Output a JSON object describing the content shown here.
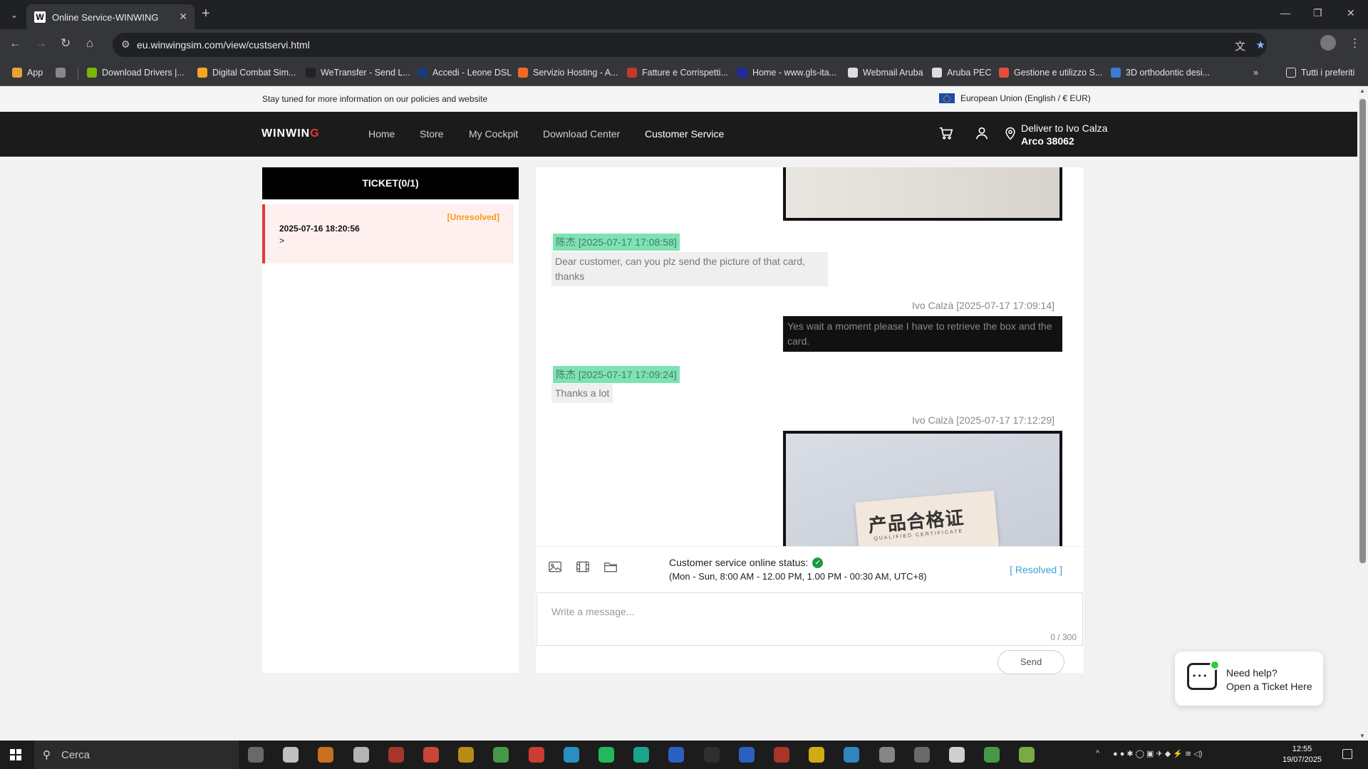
{
  "browser": {
    "tab_title": "Online Service-WINWING",
    "tab_favicon": "W",
    "url": "eu.winwingsim.com/view/custservi.html",
    "bookmarks": [
      {
        "label": "App",
        "icon": "apps-grid-icon",
        "color": "#e9a23b"
      },
      {
        "label": "",
        "icon": "grid-icon",
        "color": "#888888"
      },
      {
        "label": "Download Drivers |...",
        "icon": "nvidia-icon",
        "color": "#76b900"
      },
      {
        "label": "Digital Combat Sim...",
        "icon": "dcs-icon",
        "color": "#f5a623"
      },
      {
        "label": "WeTransfer - Send L...",
        "icon": "wetransfer-icon",
        "color": "#222222"
      },
      {
        "label": "Accedi - Leone DSL",
        "icon": "leone-icon",
        "color": "#1a3c7a"
      },
      {
        "label": "Servizio Hosting - A...",
        "icon": "aruba-icon",
        "color": "#f26b21"
      },
      {
        "label": "Fatture e Corrispetti...",
        "icon": "agenzia-entrate-icon",
        "color": "#c0392b"
      },
      {
        "label": "Home - www.gls-ita...",
        "icon": "gls-icon",
        "color": "#1e2a9e"
      },
      {
        "label": "Webmail Aruba",
        "icon": "aruba-cloud-icon",
        "color": "#dddddd"
      },
      {
        "label": "Aruba PEC",
        "icon": "aruba-pec-icon",
        "color": "#dddddd"
      },
      {
        "label": "Gestione e utilizzo S...",
        "icon": "plus-icon",
        "color": "#e74c3c"
      },
      {
        "label": "3D orthodontic desi...",
        "icon": "ortho-icon",
        "color": "#3a7bd5"
      }
    ],
    "all_bookmarks_label": "Tutti i preferiti"
  },
  "site": {
    "announcement": "Stay tuned for more information on our policies and website",
    "region": "European Union (English / € EUR)",
    "logo_main": "WINWIN",
    "logo_accent": "G",
    "nav": [
      "Home",
      "Store",
      "My Cockpit",
      "Download Center",
      "Customer Service"
    ],
    "active_nav": "Customer Service",
    "deliver_line1": "Deliver to Ivo Calza",
    "deliver_line2": "Arco 38062"
  },
  "tickets": {
    "header": "TICKET(0/1)",
    "items": [
      {
        "status": "[Unresolved]",
        "date": "2025-07-16 18:20:56",
        "arrow": ">"
      }
    ]
  },
  "chat": {
    "messages": [
      {
        "sender": "陈杰 [2025-07-17 17:08:58]",
        "text": "Dear customer, can you plz send the picture of that card, thanks"
      },
      {
        "sender": "Ivo Calzà [2025-07-17 17:09:14]",
        "text": "Yes wait a moment please I have to retrieve the box and the card."
      },
      {
        "sender": "陈杰 [2025-07-17 17:09:24]",
        "text": "Thanks a lot"
      },
      {
        "sender": "Ivo Calzà [2025-07-17 17:12:29]",
        "text": ""
      }
    ],
    "certificate_title": "产品合格证",
    "certificate_subtitle": "QUALIFIED CERTIFICATE",
    "online_status_label": "Customer service online status:",
    "hours": "(Mon - Sun, 8:00 AM - 12.00 PM, 1.00 PM - 00:30 AM, UTC+8)",
    "resolved_label": "[ Resolved ]",
    "input_placeholder": "Write a message...",
    "counter": "0 / 300",
    "send_label": "Send"
  },
  "help_widget": {
    "line1": "Need help?",
    "line2": "Open a Ticket Here"
  },
  "taskbar": {
    "search_label": "Cerca",
    "time": "12:55",
    "date": "19/07/2025"
  },
  "colors": {
    "accent_red": "#e53935",
    "unresolved": "#f39c12",
    "cs_sender_bg": "#7de3b3",
    "resolved_link": "#3aa0d8",
    "online_green": "#1e9a3e"
  }
}
